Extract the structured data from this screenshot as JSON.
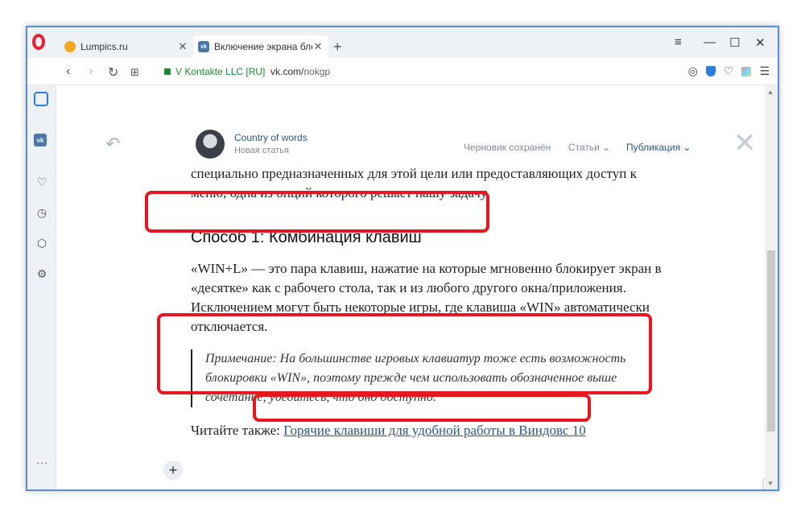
{
  "browser": {
    "tabs": [
      {
        "title": "Lumpics.ru",
        "active": false
      },
      {
        "title": "Включение экрана блокир",
        "active": true
      }
    ],
    "new_tab": "+",
    "security_label": "V Kontakte LLC [RU]",
    "url_host": "vk.com/",
    "url_path": "nokgp"
  },
  "editor": {
    "author_name": "Country of words",
    "draft_type": "Новая статья",
    "status": "Черновик сохранён",
    "articles_menu": "Статьи",
    "publish_menu": "Публикация"
  },
  "article": {
    "intro": "специально предназначенных для этой цели или предоставляющих доступ к меню, одна из опций которого решает нашу задачу.",
    "heading": "Способ 1: Комбинация клавиш",
    "paragraph": "«WIN+L» — это пара клавиш, нажатие на которые мгновенно блокирует экран в «десятке» как с рабочего стола, так и из любого другого окна/приложения. Исключением могут быть некоторые игры, где клавиша «WIN» автоматически отключается.",
    "note": "Примечание: На большинстве игровых клавиатур тоже есть возможность блокировки «WIN», поэтому прежде чем использовать обозначенное выше сочетание, убедитесь, что оно доступно.",
    "read_also": "Читайте также:",
    "read_also_link": "Горячие клавиши для удобной работы в Виндовс 10"
  },
  "colors": {
    "annotation": "#e8161f",
    "vk_blue": "#2a5885",
    "opera_red": "#e0232e"
  }
}
